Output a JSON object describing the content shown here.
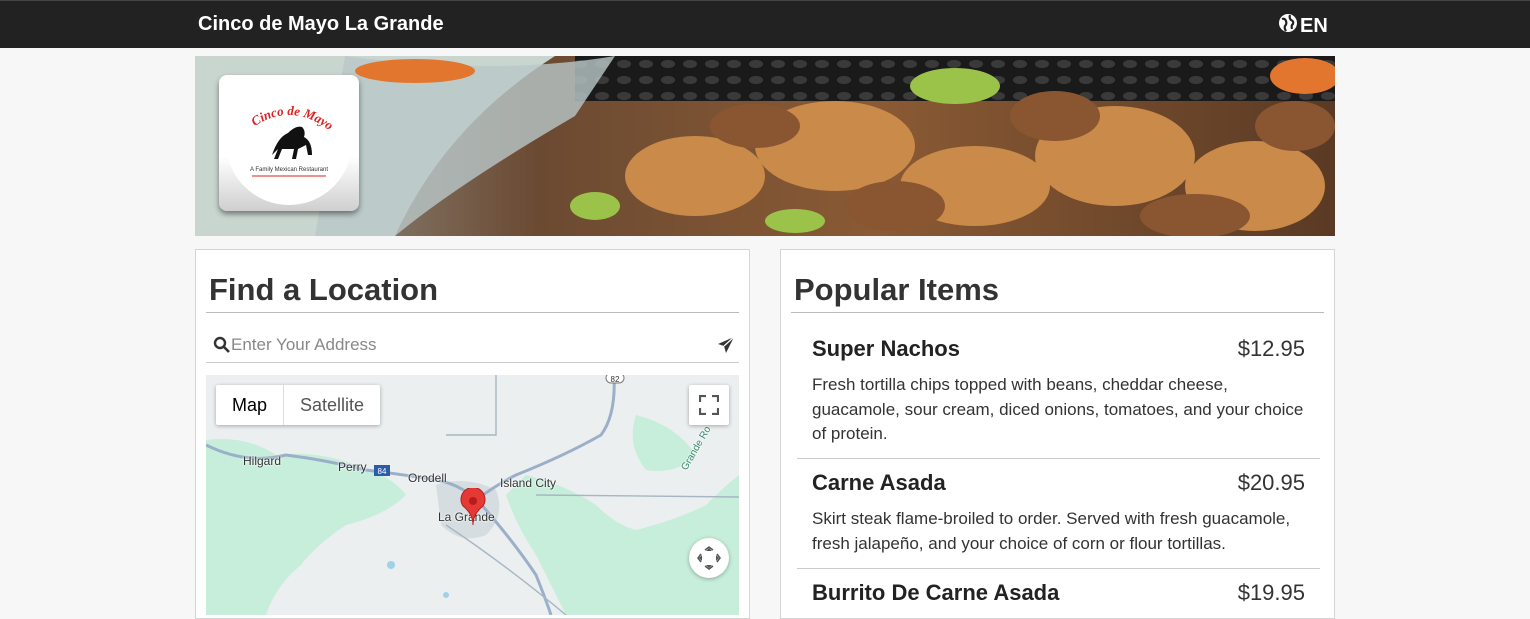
{
  "header": {
    "brand": "Cinco de Mayo La Grande",
    "language": "EN",
    "language_icon": "globe-icon"
  },
  "logo": {
    "line1": "Cinco de Mayo",
    "tagline": "A Family Mexican Restaurant"
  },
  "location": {
    "title": "Find a Location",
    "search_placeholder": "Enter Your Address",
    "search_icon": "search-icon",
    "submit_icon": "send-icon",
    "map": {
      "type_buttons": [
        "Map",
        "Satellite"
      ],
      "selected_type": "Map",
      "labels": [
        "Hilgard",
        "Perry",
        "Orodell",
        "Island City",
        "La Grande",
        "Grande Ro"
      ],
      "shields": [
        "82",
        "84"
      ],
      "marker_color": "#e53935"
    }
  },
  "popular": {
    "title": "Popular Items",
    "items": [
      {
        "name": "Super Nachos",
        "price": "$12.95",
        "description": "Fresh tortilla chips topped with beans, cheddar cheese, guacamole, sour cream, diced onions, tomatoes, and your choice of protein."
      },
      {
        "name": "Carne Asada",
        "price": "$20.95",
        "description": "Skirt steak flame-broiled to order. Served with fresh guacamole, fresh jalapeño, and your choice of corn or flour tortillas."
      },
      {
        "name": "Burrito De Carne Asada",
        "price": "$19.95",
        "description": ""
      }
    ]
  }
}
